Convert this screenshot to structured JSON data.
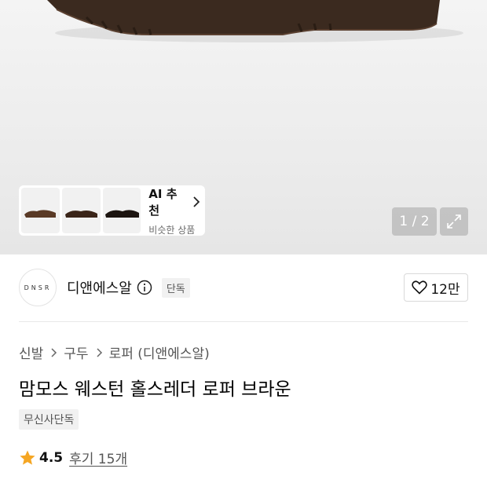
{
  "gallery": {
    "ai_card": {
      "title": "AI 추천",
      "subtitle": "비슷한 상품",
      "thumbnails": [
        "brown-loafer-thumb",
        "dark-brown-loafer-thumb",
        "black-loafer-thumb"
      ]
    },
    "pager": "1 / 2"
  },
  "brand": {
    "logo_text": "DNSR",
    "name": "디앤에스알",
    "badge": "단독",
    "likes": "12만"
  },
  "breadcrumb": [
    "신발",
    "구두",
    "로퍼 (디앤에스알)"
  ],
  "product": {
    "title": "맘모스 웨스턴 홀스레더 로퍼 브라운",
    "tag": "무신사단독",
    "rating": "4.5",
    "reviews": "후기 15개"
  },
  "colors": {
    "star": "#f5a623",
    "shoe": "#3b2a1f"
  }
}
